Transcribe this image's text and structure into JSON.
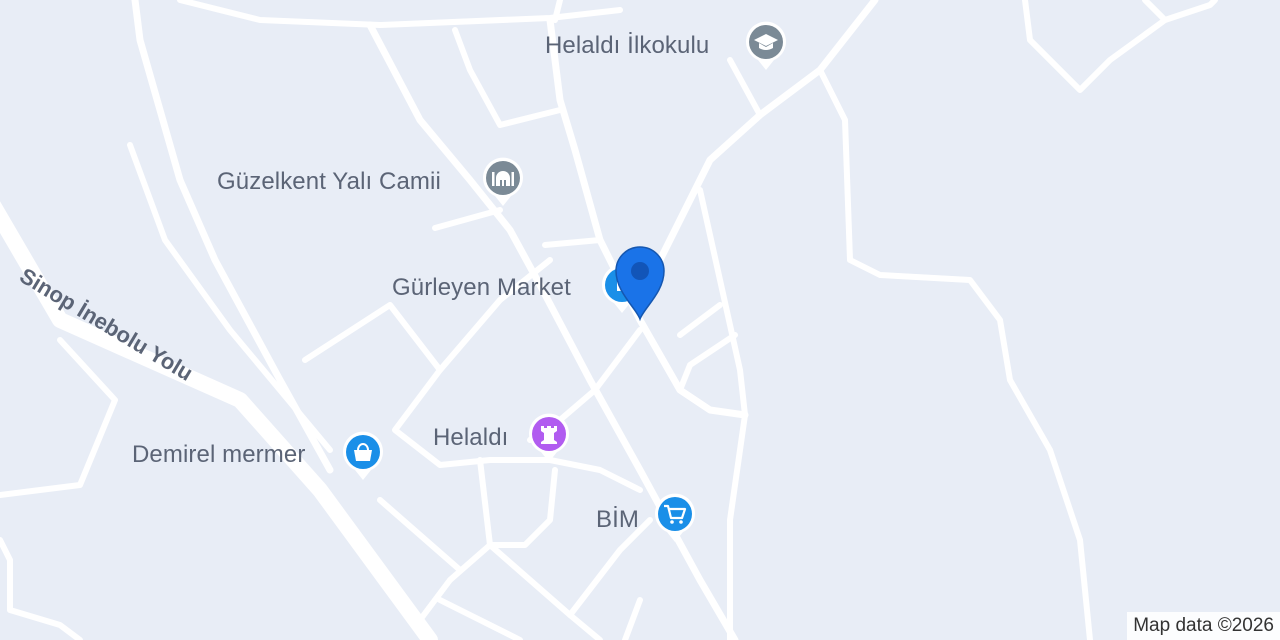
{
  "map": {
    "road_label": "Sinop İnebolu Yolu",
    "attribution": "Map data ©2026",
    "colors": {
      "background": "#e8edf6",
      "road": "#ffffff",
      "label": "#5b6476",
      "school_pin": "#7b8a96",
      "worship_pin": "#7b8a96",
      "shop_pin": "#1a8fe8",
      "landmark_pin": "#b15cf0",
      "location_marker": "#1a73e8"
    }
  },
  "pois": [
    {
      "id": "helaldi-ilkokulu",
      "label": "Helaldı İlkokulu",
      "icon": "school-icon"
    },
    {
      "id": "guzelkent-yali-camii",
      "label": "Güzelkent Yalı Camii",
      "icon": "mosque-icon"
    },
    {
      "id": "gurleyen-market",
      "label": "Gürleyen Market",
      "icon": "shopping-icon"
    },
    {
      "id": "helaldi",
      "label": "Helaldı",
      "icon": "tower-icon"
    },
    {
      "id": "demirel-mermer",
      "label": "Demirel mermer",
      "icon": "shopping-bag-icon"
    },
    {
      "id": "bim",
      "label": "BİM",
      "icon": "shopping-cart-icon"
    }
  ]
}
